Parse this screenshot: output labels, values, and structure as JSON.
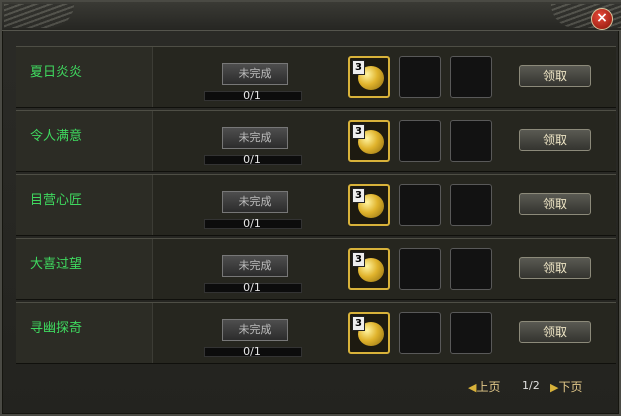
{
  "window": {
    "close_icon_glyph": "×"
  },
  "tasks": [
    {
      "name": "夏日炎炎",
      "status": "未完成",
      "progress": "0/1",
      "reward_count": "3",
      "claim_label": "领取"
    },
    {
      "name": "令人满意",
      "status": "未完成",
      "progress": "0/1",
      "reward_count": "3",
      "claim_label": "领取"
    },
    {
      "name": "目营心匠",
      "status": "未完成",
      "progress": "0/1",
      "reward_count": "3",
      "claim_label": "领取"
    },
    {
      "name": "大喜过望",
      "status": "未完成",
      "progress": "0/1",
      "reward_count": "3",
      "claim_label": "领取"
    },
    {
      "name": "寻幽探奇",
      "status": "未完成",
      "progress": "0/1",
      "reward_count": "3",
      "claim_label": "领取"
    }
  ],
  "pagination": {
    "prev_label": "上页",
    "next_label": "下页",
    "page_indicator": "1/2"
  },
  "colors": {
    "task_name": "#3fd95f",
    "reward_border": "#d8b23a"
  },
  "icons": {
    "reward": "gold-coin-icon",
    "close": "close-icon",
    "prev": "left-arrow-icon",
    "next": "right-arrow-icon"
  }
}
